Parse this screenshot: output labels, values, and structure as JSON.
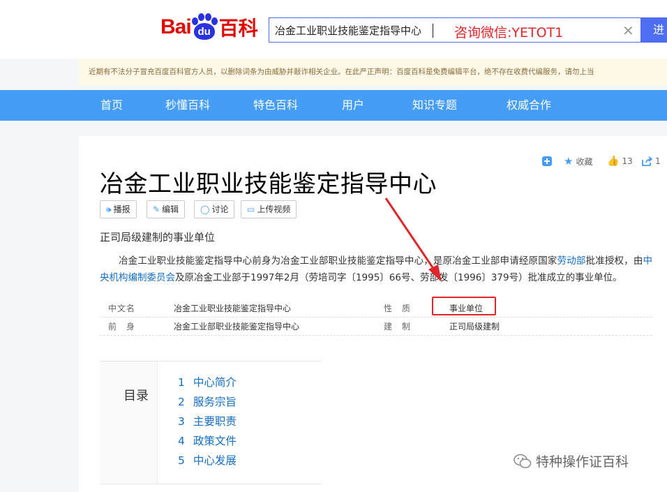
{
  "header": {
    "logo": {
      "bai": "Bai",
      "du": "du",
      "baike": "百科"
    },
    "search": {
      "value": "冶金工业职业技能鉴定指导中心",
      "button_label": "进"
    },
    "watermark_overlay": "咨询微信:YETOT1"
  },
  "notice": "近期有不法分子冒充百度百科官方人员，以删除词条为由威胁并敲诈相关企业。在此严正声明：百度百科是免费编辑平台，绝不存在收费代编服务，请勿上当",
  "nav": [
    "首页",
    "秒懂百科",
    "特色百科",
    "用户",
    "知识专题",
    "权威合作"
  ],
  "tools": {
    "collect": "收藏",
    "like_count": "13",
    "share_count": "1"
  },
  "article": {
    "title": "冶金工业职业技能鉴定指导中心",
    "actions": [
      "播报",
      "编辑",
      "讨论",
      "上传视频"
    ],
    "subtitle": "正司局级建制的事业单位",
    "summary": {
      "p1": "冶金工业职业技能鉴定指导中心前身为冶金工业部职业技能鉴定指导中心，是原冶金工业部申请经原国家",
      "link1": "劳动部",
      "p2": "批准授权，由",
      "link2": "中央机构编制委员会",
      "p3": "及原冶金工业部于1997年2月（劳培司字〔1995〕66号、劳部发〔1996〕379号）批准成立的事业单位。"
    },
    "basic_info": [
      {
        "label": "中文名",
        "value": "冶金工业职业技能鉴定指导中心",
        "label2": "性　质",
        "value2": "事业单位"
      },
      {
        "label": "前　身",
        "value": "冶金工业部职业技能鉴定指导中心",
        "label2": "建　制",
        "value2": "正司局级建制"
      }
    ]
  },
  "catalog": {
    "title": "目录",
    "items": [
      {
        "num": "1",
        "label": "中心简介"
      },
      {
        "num": "2",
        "label": "服务宗旨"
      },
      {
        "num": "3",
        "label": "主要职责"
      },
      {
        "num": "4",
        "label": "政策文件"
      },
      {
        "num": "5",
        "label": "中心发展"
      }
    ]
  },
  "bottom_watermark": "特种操作证百科",
  "colors": {
    "nav_bg": "#459df5",
    "link": "#136ec2",
    "logo_red": "#e10601",
    "logo_blue": "#2932e1",
    "annotation_red": "#e0262b"
  }
}
